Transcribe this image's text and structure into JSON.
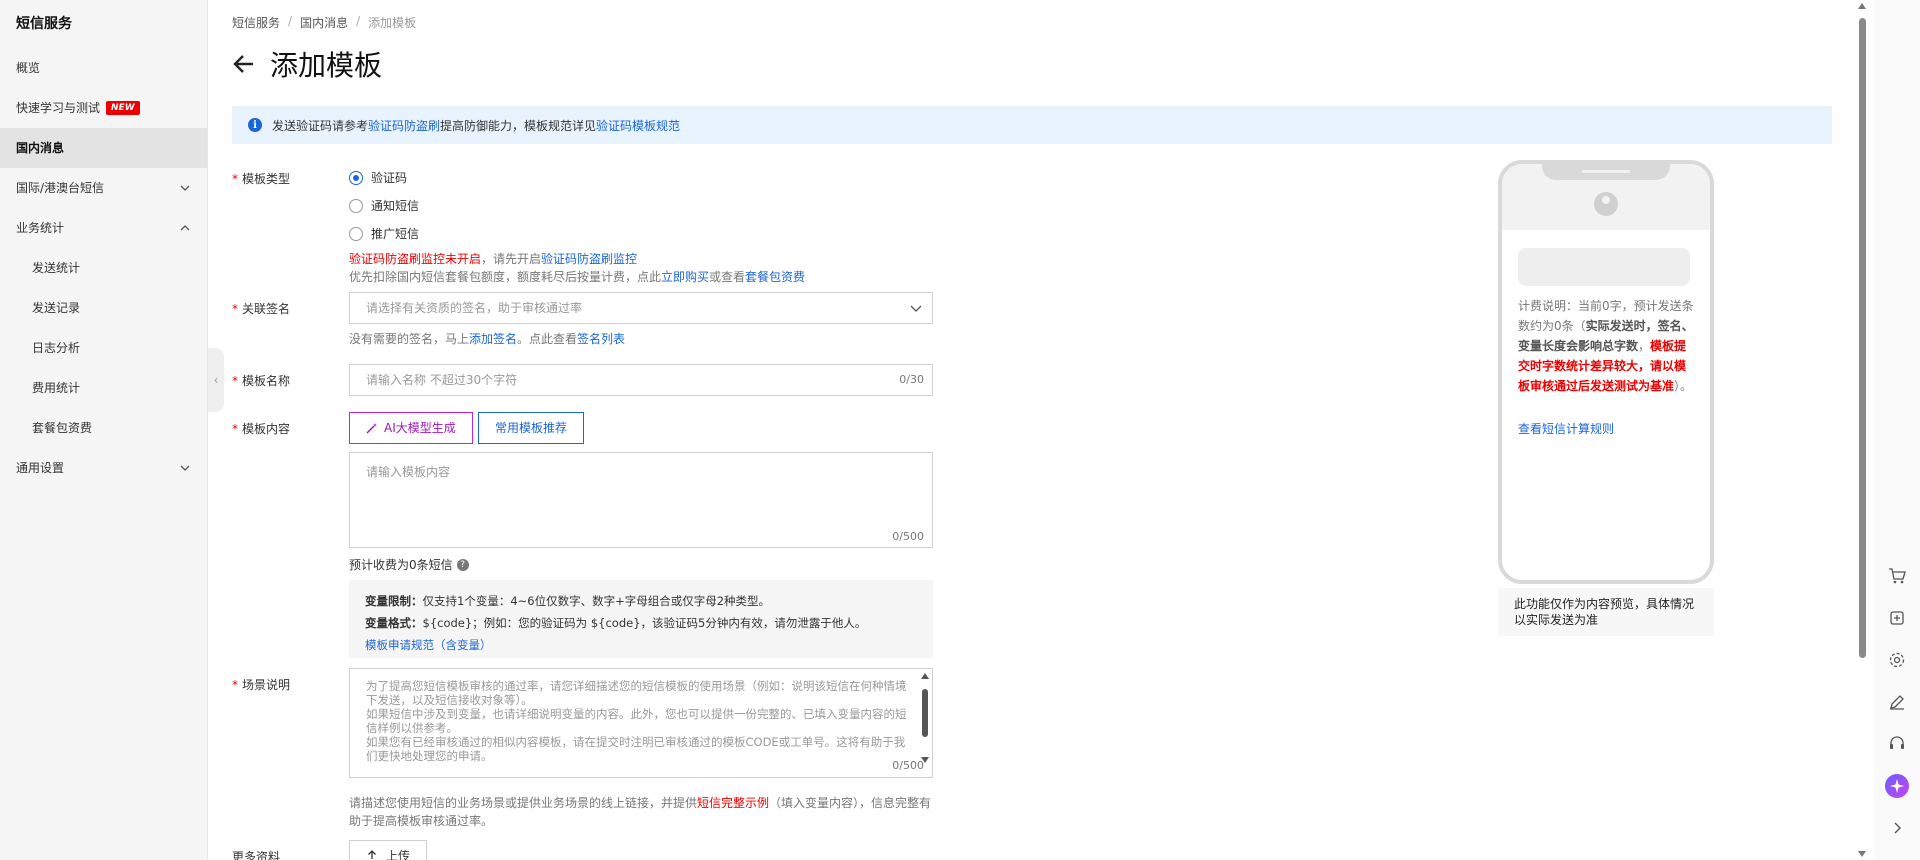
{
  "sidebar": {
    "title": "短信服务",
    "items": [
      {
        "label": "概览"
      },
      {
        "label": "快速学习与测试",
        "badge": "NEW"
      },
      {
        "label": "国内消息"
      },
      {
        "label": "国际/港澳台短信"
      },
      {
        "label": "业务统计"
      },
      {
        "label": "发送统计"
      },
      {
        "label": "发送记录"
      },
      {
        "label": "日志分析"
      },
      {
        "label": "费用统计"
      },
      {
        "label": "套餐包资费"
      },
      {
        "label": "通用设置"
      }
    ]
  },
  "breadcrumb": [
    "短信服务",
    "国内消息",
    "添加模板"
  ],
  "page": {
    "title": "添加模板"
  },
  "notice": {
    "prefix": "发送验证码请参考",
    "link1": "验证码防盗刷",
    "middle": "提高防御能力，模板规范详见",
    "link2": "验证码模板规范"
  },
  "form": {
    "template_type": {
      "label": "模板类型",
      "options": [
        "验证码",
        "通知短信",
        "推广短信"
      ],
      "selected": "验证码",
      "warning_red": "验证码防盗刷监控未开启",
      "warning_mid": "，请先开启",
      "warning_link": "验证码防盗刷监控",
      "deduct_prefix": "优先扣除国内短信套餐包额度，额度耗尽后按量计费，点此",
      "deduct_link1": "立即购买",
      "deduct_mid": "或查看",
      "deduct_link2": "套餐包资费"
    },
    "signature": {
      "label": "关联签名",
      "placeholder": "请选择有关资质的签名，助于审核通过率",
      "help_prefix": "没有需要的签名，马上",
      "help_link1": "添加签名",
      "help_mid": "。点此查看",
      "help_link2": "签名列表"
    },
    "name": {
      "label": "模板名称",
      "placeholder": "请输入名称 不超过30个字符",
      "counter": "0/30"
    },
    "content": {
      "label": "模板内容",
      "ai_button": "AI大模型生成",
      "common_button": "常用模板推荐",
      "placeholder": "请输入模板内容",
      "counter": "0/500",
      "fee_note": "预计收费为0条短信",
      "var_limit_label": "变量限制：",
      "var_limit_text": "仅支持1个变量：4~6位仅数字、数字+字母组合或仅字母2种类型。",
      "var_format_label": "变量格式：",
      "var_format_text": "${code}；例如：您的验证码为 ${code}，该验证码5分钟内有效，请勿泄露于他人。",
      "spec_link": "模板申请规范（含变量）"
    },
    "scene": {
      "label": "场景说明",
      "placeholder_lines": [
        "为了提高您短信模板审核的通过率，请您详细描述您的短信模板的使用场景（例如：说明该短信在何种情境下发送，以及短信接收对象等）。",
        "如果短信中涉及到变量，也请详细说明变量的内容。此外，您也可以提供一份完整的、已填入变量内容的短信样例以供参考。",
        "如果您有已经审核通过的相似内容模板，请在提交时注明已审核通过的模板CODE或工单号。这将有助于我们更快地处理您的申请。"
      ],
      "counter": "0/500",
      "help_prefix": "请描述您使用短信的业务场景或提供业务场景的线上链接，并提供",
      "help_red": "短信完整示例",
      "help_suffix": "（填入变量内容），信息完整有助于提高模板审核通过率。"
    },
    "more": {
      "label": "更多资料",
      "upload_button": "上传"
    }
  },
  "preview": {
    "note_prefix": "计费说明：当前0字，预计发送条数约为0条（",
    "note_bold": "实际发送时，签名、变量长度会影响总字数",
    "note_mid": "，",
    "note_red": "模板提交时字数统计差异较大，请以模板审核通过后发送测试为基准",
    "note_suffix": "）。",
    "link": "查看短信计算规则",
    "footer": "此功能仅作为内容预览，具体情况以实际发送为准"
  },
  "colors": {
    "accent": "#1a66d8",
    "danger": "#e00000",
    "ai": "#9b19b9",
    "sidebar_bg": "#f5f5f5",
    "notice_bg": "#e8f3fd"
  },
  "tools": [
    "cart-icon",
    "api-icon",
    "gear-icon",
    "edit-icon",
    "support-icon",
    "ai-assistant-icon",
    "expand-icon"
  ]
}
